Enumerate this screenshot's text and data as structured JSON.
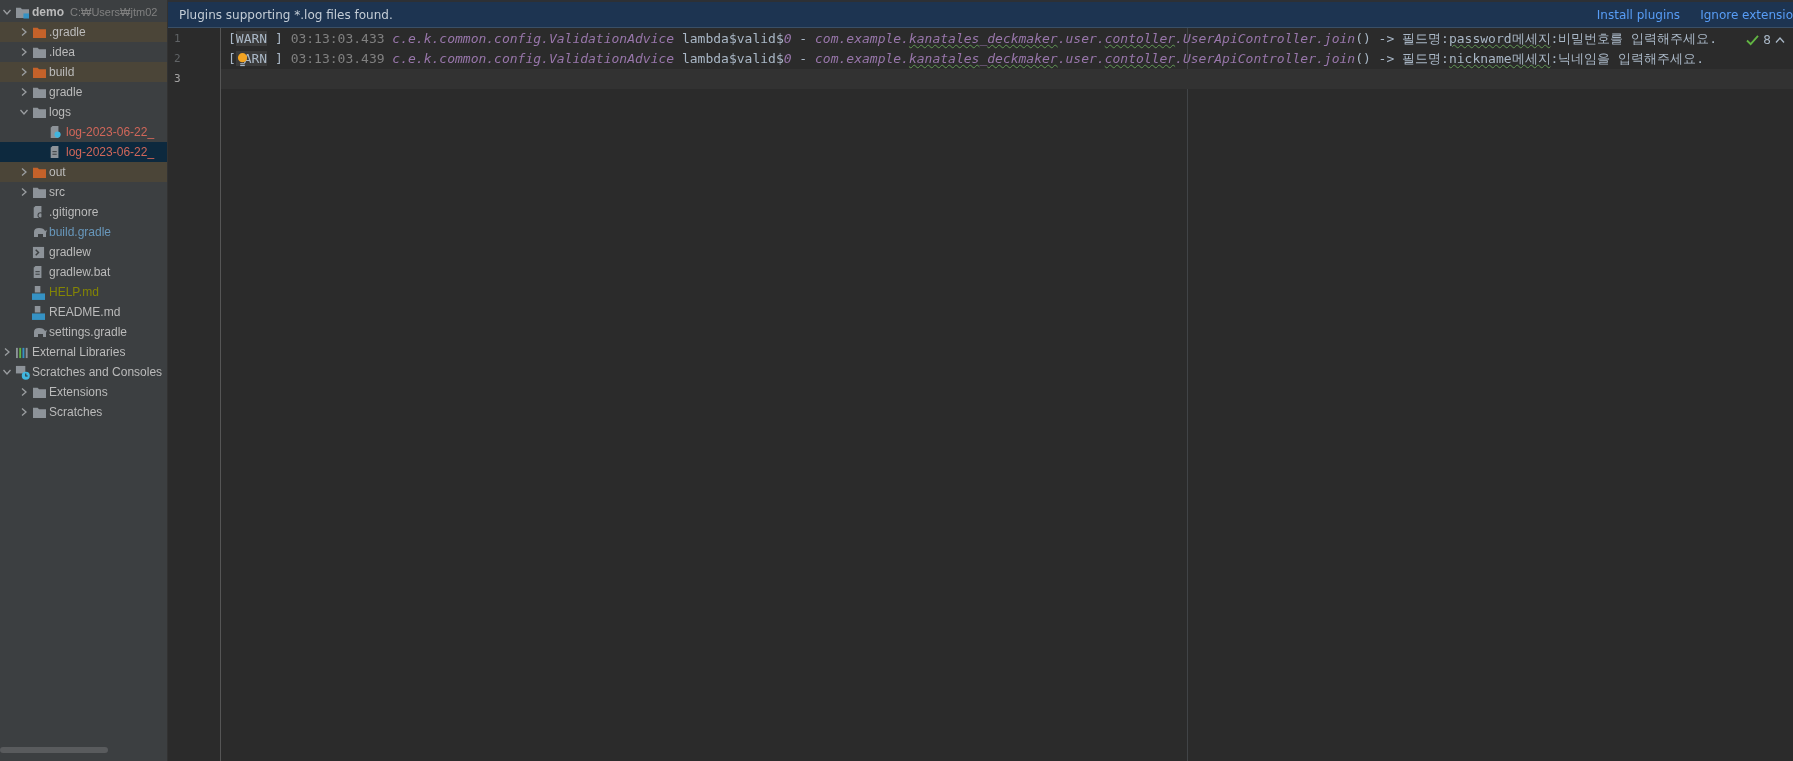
{
  "project_tree": [
    {
      "label": "demo",
      "path": "C:₩Users₩jtm02",
      "kind": "module",
      "color": "#bbbbbb",
      "expanded": true,
      "excluded": false,
      "selected": false,
      "children": [
        {
          "label": ".gradle",
          "kind": "folder",
          "color": "#bbbbbb",
          "expanded": false,
          "excluded": true,
          "selected": false
        },
        {
          "label": ".idea",
          "kind": "folder",
          "color": "#bbbbbb",
          "expanded": false,
          "excluded": false,
          "selected": false
        },
        {
          "label": "build",
          "kind": "folder",
          "color": "#bbbbbb",
          "expanded": false,
          "excluded": true,
          "selected": false
        },
        {
          "label": "gradle",
          "kind": "folder",
          "color": "#bbbbbb",
          "expanded": false,
          "excluded": false,
          "selected": false
        },
        {
          "label": "logs",
          "kind": "folder",
          "color": "#bbbbbb",
          "expanded": true,
          "excluded": false,
          "selected": false,
          "children": [
            {
              "label": "log-2023-06-22_",
              "kind": "unknown-file",
              "color": "#d1675a",
              "excluded": false,
              "selected": false
            },
            {
              "label": "log-2023-06-22_",
              "kind": "text-file",
              "color": "#d1675a",
              "excluded": false,
              "selected": true
            }
          ]
        },
        {
          "label": "out",
          "kind": "folder",
          "color": "#bbbbbb",
          "expanded": false,
          "excluded": true,
          "selected": false
        },
        {
          "label": "src",
          "kind": "folder",
          "color": "#bbbbbb",
          "expanded": false,
          "excluded": false,
          "selected": false
        },
        {
          "label": ".gitignore",
          "kind": "ignore-file",
          "color": "#bbbbbb",
          "excluded": false,
          "selected": false
        },
        {
          "label": "build.gradle",
          "kind": "gradle-file",
          "color": "#6897bb",
          "excluded": false,
          "selected": false
        },
        {
          "label": "gradlew",
          "kind": "shell-file",
          "color": "#bbbbbb",
          "excluded": false,
          "selected": false
        },
        {
          "label": "gradlew.bat",
          "kind": "text-file",
          "color": "#bbbbbb",
          "excluded": false,
          "selected": false
        },
        {
          "label": "HELP.md",
          "kind": "markdown-file",
          "color": "#848504",
          "excluded": false,
          "selected": false
        },
        {
          "label": "README.md",
          "kind": "markdown-file",
          "color": "#bbbbbb",
          "excluded": false,
          "selected": false
        },
        {
          "label": "settings.gradle",
          "kind": "gradle-file",
          "color": "#bbbbbb",
          "excluded": false,
          "selected": false
        }
      ]
    },
    {
      "label": "External Libraries",
      "kind": "libraries",
      "color": "#bbbbbb",
      "expanded": false,
      "excluded": false,
      "selected": false
    },
    {
      "label": "Scratches and Consoles",
      "kind": "scratches",
      "color": "#bbbbbb",
      "expanded": true,
      "excluded": false,
      "selected": false,
      "children": [
        {
          "label": "Extensions",
          "kind": "folder",
          "color": "#bbbbbb",
          "expanded": false,
          "excluded": false,
          "selected": false
        },
        {
          "label": "Scratches",
          "kind": "folder",
          "color": "#bbbbbb",
          "expanded": false,
          "excluded": false,
          "selected": false
        }
      ]
    }
  ],
  "notification": {
    "message": "Plugins supporting *.log files found.",
    "actions": [
      "Install plugins",
      "Ignore extensio"
    ]
  },
  "inspections": {
    "count": "8"
  },
  "editor_lines": [
    {
      "number": "1",
      "current": false,
      "bulb": false,
      "segments": [
        {
          "kind": "text",
          "text": "["
        },
        {
          "kind": "tag",
          "text": "WARN"
        },
        {
          "kind": "text",
          "text": " ] "
        },
        {
          "kind": "time",
          "text": "03:13:03.433"
        },
        {
          "kind": "code",
          "text": " c.e.k.common.config.ValidationAdvice"
        },
        {
          "kind": "text",
          "text": " lambda$valid$"
        },
        {
          "kind": "code",
          "text": "0"
        },
        {
          "kind": "text",
          "text": " - "
        },
        {
          "kind": "code",
          "text": "com.example."
        },
        {
          "kind": "code-typo",
          "text": "kanatales"
        },
        {
          "kind": "code",
          "text": "_"
        },
        {
          "kind": "code-typo",
          "text": "deckmaker"
        },
        {
          "kind": "code",
          "text": ".user."
        },
        {
          "kind": "code-typo",
          "text": "contoller"
        },
        {
          "kind": "code",
          "text": ".UserApiController.join"
        },
        {
          "kind": "text",
          "text": "() -> 필드명:"
        },
        {
          "kind": "text-typo",
          "text": "password메세지"
        },
        {
          "kind": "text",
          "text": ":비밀번호를 입력해주세요."
        }
      ]
    },
    {
      "number": "2",
      "current": false,
      "bulb": true,
      "segments": [
        {
          "kind": "text",
          "text": "["
        },
        {
          "kind": "tag",
          "text": " ARN"
        },
        {
          "kind": "text",
          "text": " ] "
        },
        {
          "kind": "time",
          "text": "03:13:03.439"
        },
        {
          "kind": "code",
          "text": " c.e.k.common.config.ValidationAdvice"
        },
        {
          "kind": "text",
          "text": " lambda$valid$"
        },
        {
          "kind": "code",
          "text": "0"
        },
        {
          "kind": "text",
          "text": " - "
        },
        {
          "kind": "code",
          "text": "com.example."
        },
        {
          "kind": "code-typo",
          "text": "kanatales"
        },
        {
          "kind": "code",
          "text": "_"
        },
        {
          "kind": "code-typo",
          "text": "deckmaker"
        },
        {
          "kind": "code",
          "text": ".user."
        },
        {
          "kind": "code-typo",
          "text": "contoller"
        },
        {
          "kind": "code",
          "text": ".UserApiController.join"
        },
        {
          "kind": "text",
          "text": "() -> 필드명:"
        },
        {
          "kind": "text-typo",
          "text": "nickname메세지"
        },
        {
          "kind": "text",
          "text": ":닉네임을 입력해주세요."
        }
      ]
    },
    {
      "number": "3",
      "current": true,
      "bulb": false
    }
  ]
}
